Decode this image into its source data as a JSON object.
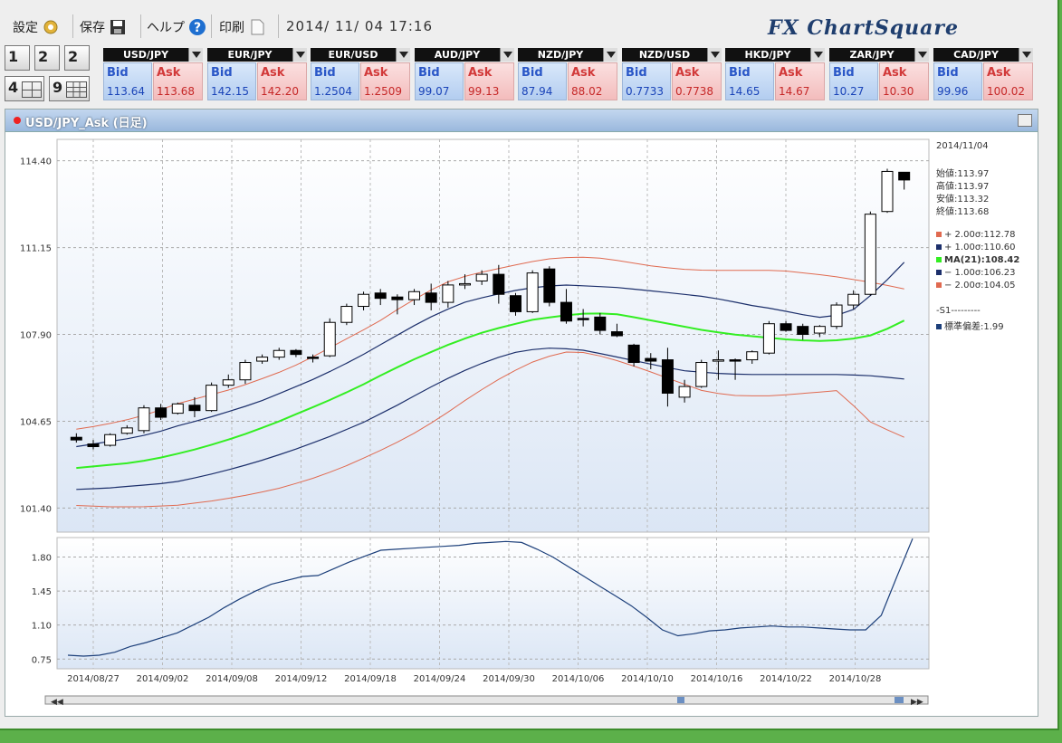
{
  "toolbar": {
    "settings_label": "設定",
    "save_label": "保存",
    "help_label": "ヘルプ",
    "print_label": "印刷",
    "datetime": "2014/ 11/ 04  17:16",
    "logo": "FX ChartSquare"
  },
  "layouts": [
    "1",
    "2",
    "2",
    "4",
    "9"
  ],
  "quotes": [
    {
      "symbol": "USD/JPY",
      "bid_label": "Bid",
      "ask_label": "Ask",
      "bid": "113.64",
      "ask": "113.68"
    },
    {
      "symbol": "EUR/JPY",
      "bid_label": "Bid",
      "ask_label": "Ask",
      "bid": "142.15",
      "ask": "142.20"
    },
    {
      "symbol": "EUR/USD",
      "bid_label": "Bid",
      "ask_label": "Ask",
      "bid": "1.2504",
      "ask": "1.2509"
    },
    {
      "symbol": "AUD/JPY",
      "bid_label": "Bid",
      "ask_label": "Ask",
      "bid": "99.07",
      "ask": "99.13"
    },
    {
      "symbol": "NZD/JPY",
      "bid_label": "Bid",
      "ask_label": "Ask",
      "bid": "87.94",
      "ask": "88.02"
    },
    {
      "symbol": "NZD/USD",
      "bid_label": "Bid",
      "ask_label": "Ask",
      "bid": "0.7733",
      "ask": "0.7738"
    },
    {
      "symbol": "HKD/JPY",
      "bid_label": "Bid",
      "ask_label": "Ask",
      "bid": "14.65",
      "ask": "14.67"
    },
    {
      "symbol": "ZAR/JPY",
      "bid_label": "Bid",
      "ask_label": "Ask",
      "bid": "10.27",
      "ask": "10.30"
    },
    {
      "symbol": "CAD/JPY",
      "bid_label": "Bid",
      "ask_label": "Ask",
      "bid": "99.96",
      "ask": "100.02"
    }
  ],
  "panel": {
    "title": "USD/JPY_Ask (日足)",
    "legend": {
      "date": "2014/11/04",
      "open": "始値:113.97",
      "high": "高値:113.97",
      "low": "安値:113.32",
      "close": "終値:113.68",
      "bb_p2": "+ 2.00σ:112.78",
      "bb_p1": "+ 1.00σ:110.60",
      "ma": "MA(21):108.42",
      "bb_m1": "− 1.00σ:106.23",
      "bb_m2": "− 2.00σ:104.05",
      "sub_title": "-S1---------",
      "sub_std": "標準偏差:1.99"
    },
    "colors": {
      "bb2": "#e06a50",
      "bb1": "#1c2f6b",
      "ma": "#33ee22",
      "std": "#1c3f7a"
    }
  },
  "chart_data": {
    "type": "candlestick",
    "ylim": [
      100.5,
      115.2
    ],
    "yticks": [
      "114.40",
      "111.15",
      "107.90",
      "104.65",
      "101.40"
    ],
    "xticks": [
      "2014/08/27",
      "2014/09/02",
      "2014/09/08",
      "2014/09/12",
      "2014/09/18",
      "2014/09/24",
      "2014/09/30",
      "2014/10/06",
      "2014/10/10",
      "2014/10/16",
      "2014/10/22",
      "2014/10/28"
    ],
    "candles": [
      {
        "o": 104.05,
        "h": 104.2,
        "l": 103.85,
        "c": 103.95
      },
      {
        "o": 103.8,
        "h": 103.95,
        "l": 103.6,
        "c": 103.7
      },
      {
        "o": 103.75,
        "h": 104.2,
        "l": 103.7,
        "c": 104.15
      },
      {
        "o": 104.2,
        "h": 104.5,
        "l": 104.15,
        "c": 104.4
      },
      {
        "o": 104.3,
        "h": 105.25,
        "l": 104.2,
        "c": 105.15
      },
      {
        "o": 105.15,
        "h": 105.3,
        "l": 104.7,
        "c": 104.8
      },
      {
        "o": 104.95,
        "h": 105.35,
        "l": 104.9,
        "c": 105.3
      },
      {
        "o": 105.25,
        "h": 105.55,
        "l": 104.8,
        "c": 105.05
      },
      {
        "o": 105.05,
        "h": 106.1,
        "l": 105.0,
        "c": 106.0
      },
      {
        "o": 106.0,
        "h": 106.4,
        "l": 105.9,
        "c": 106.2
      },
      {
        "o": 106.2,
        "h": 106.95,
        "l": 106.05,
        "c": 106.85
      },
      {
        "o": 106.9,
        "h": 107.15,
        "l": 106.8,
        "c": 107.05
      },
      {
        "o": 107.05,
        "h": 107.4,
        "l": 106.95,
        "c": 107.3
      },
      {
        "o": 107.3,
        "h": 107.35,
        "l": 107.05,
        "c": 107.15
      },
      {
        "o": 107.05,
        "h": 107.15,
        "l": 106.85,
        "c": 107.0
      },
      {
        "o": 107.1,
        "h": 108.5,
        "l": 107.05,
        "c": 108.35
      },
      {
        "o": 108.35,
        "h": 109.05,
        "l": 108.25,
        "c": 108.95
      },
      {
        "o": 108.95,
        "h": 109.5,
        "l": 108.8,
        "c": 109.4
      },
      {
        "o": 109.45,
        "h": 109.6,
        "l": 109.0,
        "c": 109.25
      },
      {
        "o": 109.3,
        "h": 109.4,
        "l": 108.65,
        "c": 109.2
      },
      {
        "o": 109.2,
        "h": 109.6,
        "l": 109.0,
        "c": 109.5
      },
      {
        "o": 109.45,
        "h": 109.8,
        "l": 108.8,
        "c": 109.1
      },
      {
        "o": 109.1,
        "h": 109.9,
        "l": 108.9,
        "c": 109.75
      },
      {
        "o": 109.75,
        "h": 110.15,
        "l": 109.6,
        "c": 109.8
      },
      {
        "o": 109.9,
        "h": 110.3,
        "l": 109.75,
        "c": 110.15
      },
      {
        "o": 110.15,
        "h": 110.5,
        "l": 109.05,
        "c": 109.4
      },
      {
        "o": 109.35,
        "h": 109.45,
        "l": 108.6,
        "c": 108.75
      },
      {
        "o": 108.75,
        "h": 110.3,
        "l": 108.7,
        "c": 110.2
      },
      {
        "o": 110.35,
        "h": 110.45,
        "l": 108.95,
        "c": 109.1
      },
      {
        "o": 109.1,
        "h": 109.6,
        "l": 108.3,
        "c": 108.4
      },
      {
        "o": 108.5,
        "h": 108.85,
        "l": 108.2,
        "c": 108.45
      },
      {
        "o": 108.55,
        "h": 108.7,
        "l": 107.9,
        "c": 108.05
      },
      {
        "o": 108.0,
        "h": 108.3,
        "l": 107.8,
        "c": 107.85
      },
      {
        "o": 107.5,
        "h": 107.55,
        "l": 106.7,
        "c": 106.85
      },
      {
        "o": 107.0,
        "h": 107.2,
        "l": 106.6,
        "c": 106.9
      },
      {
        "o": 106.95,
        "h": 107.4,
        "l": 105.2,
        "c": 105.7
      },
      {
        "o": 105.55,
        "h": 106.2,
        "l": 105.35,
        "c": 105.95
      },
      {
        "o": 105.95,
        "h": 106.95,
        "l": 105.9,
        "c": 106.85
      },
      {
        "o": 106.9,
        "h": 107.3,
        "l": 106.2,
        "c": 106.95
      },
      {
        "o": 106.95,
        "h": 107.0,
        "l": 106.2,
        "c": 106.9
      },
      {
        "o": 106.95,
        "h": 107.3,
        "l": 106.8,
        "c": 107.25
      },
      {
        "o": 107.2,
        "h": 108.4,
        "l": 107.15,
        "c": 108.3
      },
      {
        "o": 108.3,
        "h": 108.4,
        "l": 108.0,
        "c": 108.05
      },
      {
        "o": 108.2,
        "h": 108.3,
        "l": 107.7,
        "c": 107.9
      },
      {
        "o": 107.95,
        "h": 108.25,
        "l": 107.8,
        "c": 108.2
      },
      {
        "o": 108.2,
        "h": 109.1,
        "l": 108.1,
        "c": 109.0
      },
      {
        "o": 109.0,
        "h": 109.55,
        "l": 108.85,
        "c": 109.4
      },
      {
        "o": 109.4,
        "h": 112.5,
        "l": 109.35,
        "c": 112.4
      },
      {
        "o": 112.5,
        "h": 114.1,
        "l": 112.45,
        "c": 114.0
      },
      {
        "o": 113.97,
        "h": 113.97,
        "l": 113.32,
        "c": 113.68
      }
    ],
    "bb_upper2": [
      104.35,
      104.5,
      104.7,
      104.95,
      105.3,
      105.55,
      105.8,
      106.1,
      106.45,
      106.85,
      107.35,
      107.85,
      108.35,
      108.95,
      109.5,
      109.95,
      110.2,
      110.4,
      110.6,
      110.75,
      110.8,
      110.75,
      110.6,
      110.45,
      110.35,
      110.3,
      110.3,
      110.3,
      110.3,
      110.2,
      110.1,
      109.95,
      109.8,
      109.6
    ],
    "bb_upper1": [
      103.7,
      103.85,
      104.0,
      104.2,
      104.5,
      104.75,
      105.05,
      105.35,
      105.75,
      106.15,
      106.6,
      107.1,
      107.65,
      108.2,
      108.7,
      109.1,
      109.35,
      109.55,
      109.7,
      109.75,
      109.7,
      109.65,
      109.55,
      109.45,
      109.35,
      109.2,
      109.0,
      108.85,
      108.65,
      108.5,
      108.8,
      109.6,
      110.6
    ],
    "ma": [
      102.9,
      103.0,
      103.1,
      103.3,
      103.55,
      103.85,
      104.2,
      104.6,
      105.05,
      105.5,
      106.0,
      106.55,
      107.05,
      107.5,
      107.9,
      108.2,
      108.45,
      108.6,
      108.7,
      108.65,
      108.45,
      108.25,
      108.05,
      107.9,
      107.8,
      107.7,
      107.65,
      107.7,
      107.9,
      108.42
    ],
    "bb_lower1": [
      102.1,
      102.15,
      102.25,
      102.35,
      102.6,
      102.9,
      103.25,
      103.65,
      104.1,
      104.6,
      105.2,
      105.85,
      106.45,
      106.95,
      107.3,
      107.4,
      107.3,
      107.05,
      106.8,
      106.55,
      106.45,
      106.4,
      106.4,
      106.4,
      106.4,
      106.35,
      106.23
    ],
    "bb_lower2": [
      101.5,
      101.45,
      101.45,
      101.5,
      101.65,
      101.85,
      102.1,
      102.45,
      102.9,
      103.45,
      104.05,
      104.8,
      105.65,
      106.4,
      107.0,
      107.3,
      107.05,
      106.65,
      106.2,
      105.75,
      105.6,
      105.6,
      105.7,
      105.8,
      104.6,
      104.05
    ],
    "std_ylim": [
      0.65,
      2.0
    ],
    "std_yticks": [
      "1.80",
      "1.45",
      "1.10",
      "0.75"
    ],
    "std": [
      0.79,
      0.78,
      0.79,
      0.82,
      0.88,
      0.92,
      0.97,
      1.02,
      1.1,
      1.18,
      1.28,
      1.37,
      1.45,
      1.52,
      1.56,
      1.6,
      1.61,
      1.68,
      1.75,
      1.81,
      1.87,
      1.88,
      1.89,
      1.9,
      1.91,
      1.92,
      1.94,
      1.95,
      1.96,
      1.95,
      1.88,
      1.8,
      1.7,
      1.6,
      1.5,
      1.4,
      1.3,
      1.18,
      1.05,
      0.99,
      1.01,
      1.04,
      1.05,
      1.07,
      1.08,
      1.09,
      1.08,
      1.08,
      1.07,
      1.06,
      1.05,
      1.05,
      1.2,
      1.6,
      1.99
    ]
  }
}
